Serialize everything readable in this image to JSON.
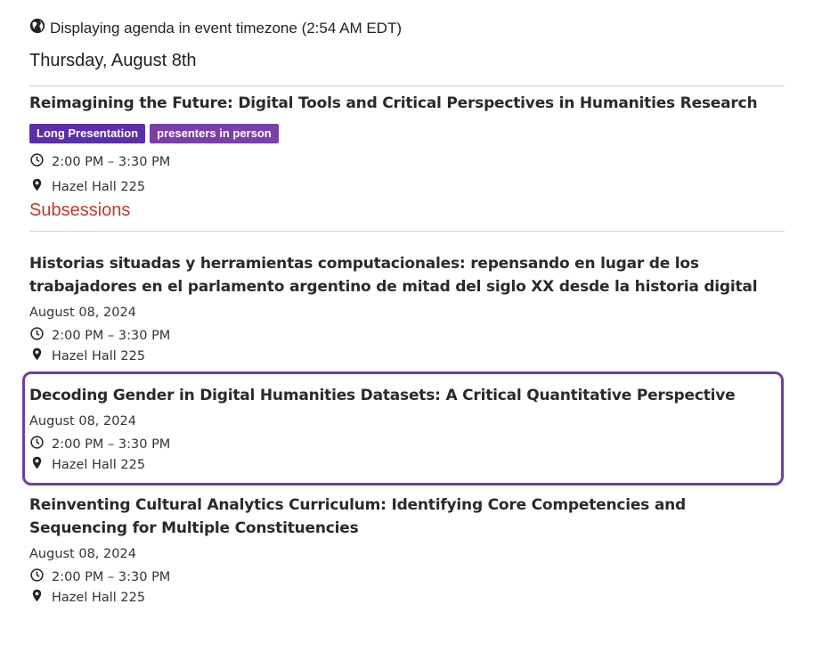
{
  "timezone": {
    "text": "Displaying agenda in event timezone (2:54 AM EDT)"
  },
  "day": {
    "heading": "Thursday, August 8th"
  },
  "main_session": {
    "title": "Reimagining the Future: Digital Tools and Critical Perspectives in Humanities Research",
    "tags": [
      {
        "label": "Long Presentation",
        "color": "#5b2fa8"
      },
      {
        "label": "presenters in person",
        "color": "#7b3fa8"
      }
    ],
    "time": "2:00 PM – 3:30 PM",
    "location": "Hazel Hall 225",
    "subsessions_label": "Subsessions"
  },
  "subsessions": [
    {
      "title": "Historias situadas y herramientas computacionales: repensando en lugar de los trabajadores en el parlamento argentino de mitad del siglo XX desde la historia digital",
      "date": "August 08, 2024",
      "time": "2:00 PM – 3:30 PM",
      "location": "Hazel Hall 225"
    },
    {
      "title": "Decoding Gender in Digital Humanities Datasets: A Critical Quantitative Perspective",
      "date": "August 08, 2024",
      "time": "2:00 PM – 3:30 PM",
      "location": "Hazel Hall 225",
      "highlighted": true
    },
    {
      "title": "Reinventing Cultural Analytics Curriculum: Identifying Core Competencies and Sequencing for Multiple Constituencies",
      "date": "August 08, 2024",
      "time": "2:00 PM – 3:30 PM",
      "location": "Hazel Hall 225"
    }
  ],
  "colors": {
    "accent": "#6f3fa0",
    "link": "#c0392b"
  }
}
